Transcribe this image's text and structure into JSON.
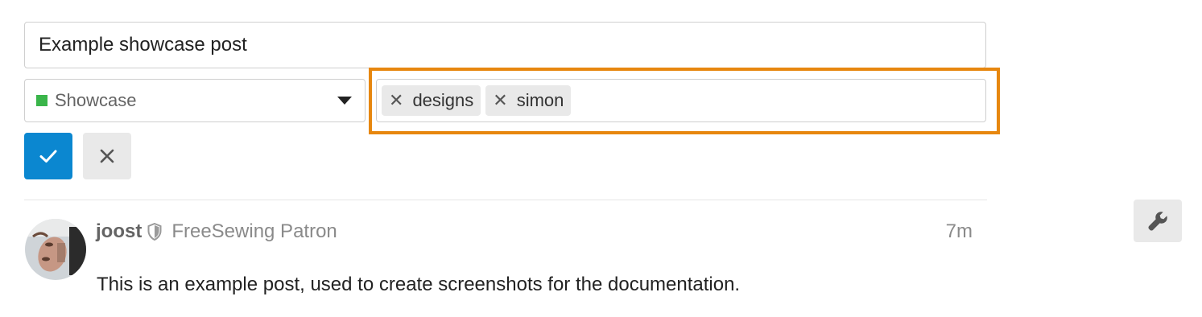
{
  "editor": {
    "title_value": "Example showcase post",
    "category": {
      "label": "Showcase",
      "color": "#3ab54a",
      "chevron_icon": "caret-down-icon"
    },
    "tags": [
      {
        "label": "designs",
        "remove_icon": "x-icon"
      },
      {
        "label": "simon",
        "remove_icon": "x-icon"
      }
    ],
    "highlight_color": "#e7870f",
    "save_icon": "check-icon",
    "cancel_icon": "x-icon",
    "accent_color": "#0b87d0"
  },
  "post": {
    "username": "joost",
    "user_badge_icon": "shield-icon",
    "user_title": "FreeSewing Patron",
    "time": "7m",
    "body": "This is an example post, used to create screenshots for the documentation."
  },
  "admin": {
    "wrench_icon": "wrench-icon"
  }
}
